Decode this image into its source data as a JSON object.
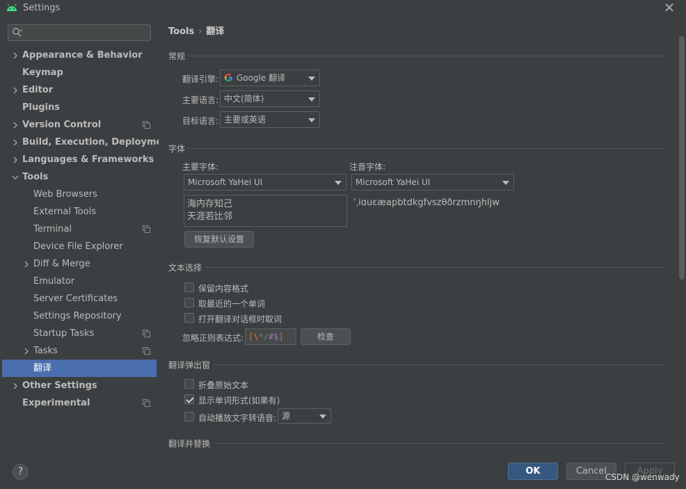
{
  "window": {
    "title": "Settings",
    "close_glyph": "✕"
  },
  "search": {
    "placeholder": ""
  },
  "sidebar": {
    "items": [
      {
        "label": "Appearance & Behavior",
        "bold": true,
        "expandable": true
      },
      {
        "label": "Keymap",
        "bold": true
      },
      {
        "label": "Editor",
        "bold": true,
        "expandable": true
      },
      {
        "label": "Plugins",
        "bold": true
      },
      {
        "label": "Version Control",
        "bold": true,
        "expandable": true,
        "project_icon": true
      },
      {
        "label": "Build, Execution, Deployment",
        "bold": true,
        "expandable": true
      },
      {
        "label": "Languages & Frameworks",
        "bold": true,
        "expandable": true
      },
      {
        "label": "Tools",
        "bold": true,
        "expanded": true
      },
      {
        "label": "Web Browsers"
      },
      {
        "label": "External Tools"
      },
      {
        "label": "Terminal",
        "project_icon": true
      },
      {
        "label": "Device File Explorer"
      },
      {
        "label": "Diff & Merge",
        "expandable": true
      },
      {
        "label": "Emulator"
      },
      {
        "label": "Server Certificates"
      },
      {
        "label": "Settings Repository"
      },
      {
        "label": "Startup Tasks",
        "project_icon": true
      },
      {
        "label": "Tasks",
        "expandable": true,
        "project_icon": true
      },
      {
        "label": "翻译",
        "selected": true
      },
      {
        "label": "Other Settings",
        "bold": true,
        "expandable": true
      },
      {
        "label": "Experimental",
        "bold": true,
        "project_icon": true
      }
    ]
  },
  "breadcrumb": {
    "parent": "Tools",
    "separator": "›",
    "current": "翻译"
  },
  "general": {
    "title": "常规",
    "engine_label": "翻译引擎:",
    "engine_value": "Google 翻译",
    "primary_lang_label": "主要语言:",
    "primary_lang_value": "中文(简体)",
    "target_lang_label": "目标语言:",
    "target_lang_value": "主要或英语"
  },
  "fonts": {
    "title": "字体",
    "primary_font_label": "主要字体:",
    "primary_font_value": "Microsoft YaHei UI",
    "phonetic_font_label": "注音字体:",
    "phonetic_font_value": "Microsoft YaHei UI",
    "preview_line1": "海内存知己",
    "preview_line2": "天涯若比邻",
    "phonetic_preview": "ˈˌiɑuɛæapbtdkgfvszθðrzmnŋhljw",
    "restore_button": "恢复默认设置"
  },
  "text_selection": {
    "title": "文本选择",
    "keep_format_label": "保留内容格式",
    "keep_format_checked": false,
    "nearest_word_label": "取最近的一个单词",
    "nearest_word_checked": false,
    "take_on_open_label": "打开翻译对话框时取词",
    "take_on_open_checked": false,
    "ignore_regex_label": "忽略正则表达式:",
    "ignore_regex_value": "[\\*/#$]",
    "check_button": "检查"
  },
  "popup": {
    "title": "翻译弹出窗",
    "fold_original_label": "折叠原始文本",
    "fold_original_checked": false,
    "show_word_forms_label": "显示单词形式(如果有)",
    "show_word_forms_checked": true,
    "auto_tts_label": "自动播放文字转语音:",
    "auto_tts_checked": false,
    "auto_tts_value": "源"
  },
  "replace": {
    "title": "翻译并替换"
  },
  "footer": {
    "help_label": "?",
    "ok_label": "OK",
    "cancel_label": "Cancel",
    "apply_label": "Apply",
    "watermark": "CSDN @wenwady"
  },
  "colors": {
    "background": "#3c3f41",
    "selection": "#4b6eaf",
    "ok_button": "#365880",
    "android_green": "#3ddc84"
  },
  "icons": {
    "app": "android-icon",
    "search": "search-icon",
    "close": "close-icon",
    "expand": "chevron-right-icon",
    "expanded": "chevron-down-icon",
    "project": "project-level-icon",
    "google": "google-g-icon",
    "dropdown": "dropdown-arrow-icon",
    "check": "checkmark-icon"
  }
}
